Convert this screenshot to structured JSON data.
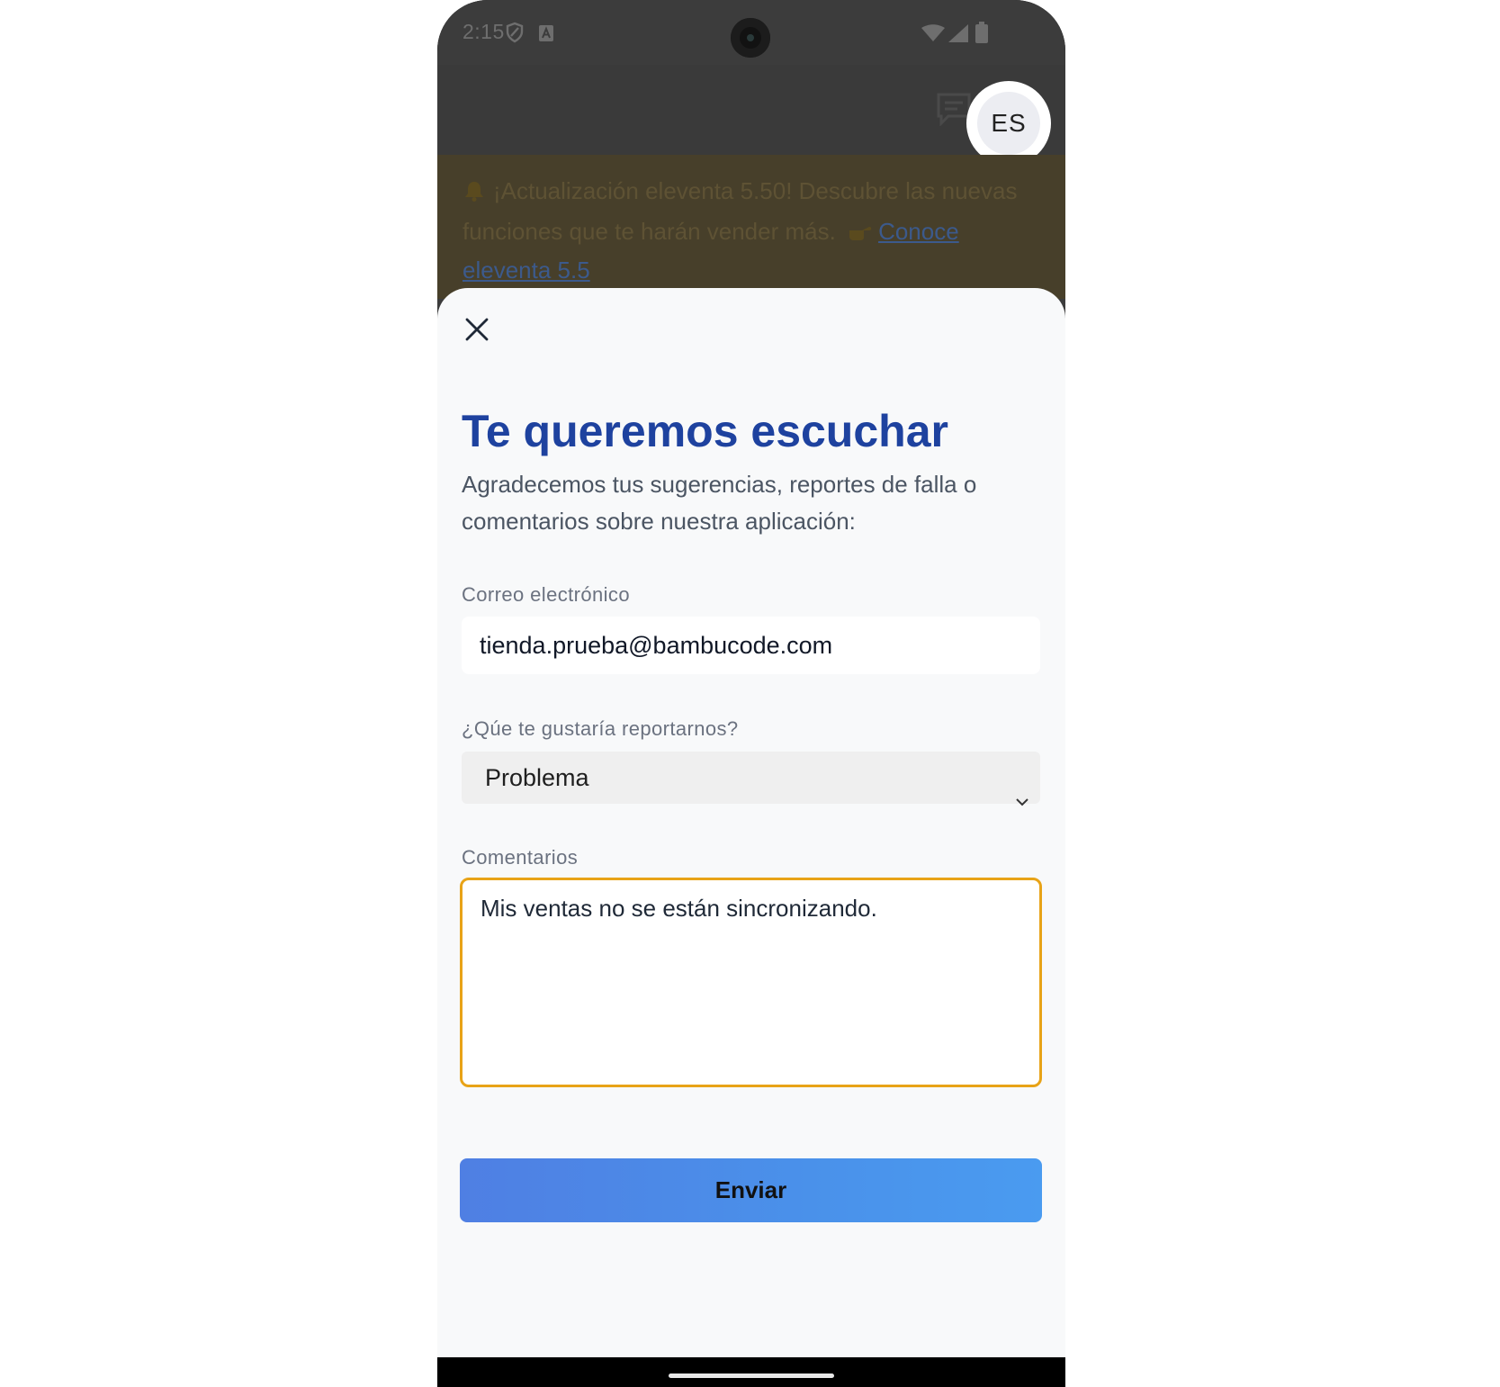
{
  "status_bar": {
    "time": "2:15",
    "icons": [
      "shield-icon",
      "a-icon",
      "wifi-icon",
      "signal-icon",
      "battery-icon"
    ]
  },
  "app_bar": {
    "avatar_initials": "ES",
    "icons": [
      "chat-icon"
    ]
  },
  "banner": {
    "text": "¡Actualización eleventa 5.50! Descubre las nuevas funciones que te harán vender más.",
    "link_text": "Conoce eleventa 5.5",
    "icons": [
      "bell-icon",
      "hand-pointing-icon"
    ]
  },
  "feedback_sheet": {
    "title": "Te queremos escuchar",
    "subtitle": "Agradecemos tus sugerencias, reportes de falla o comentarios sobre nuestra aplicación:",
    "email_label": "Correo electrónico",
    "email_value": "tienda.prueba@bambucode.com",
    "report_type_label": "¿Qúe te gustaría reportarnos?",
    "report_type_value": "Problema",
    "comments_label": "Comentarios",
    "comments_value": "Mis ventas no se están sincronizando.",
    "submit_label": "Enviar"
  },
  "colors": {
    "title": "#1e429f",
    "textarea_focus_border": "#e8a317",
    "button_gradient_start": "#4f7fe3",
    "button_gradient_end": "#4a9bf0",
    "scrim": "#3c3c3c"
  }
}
